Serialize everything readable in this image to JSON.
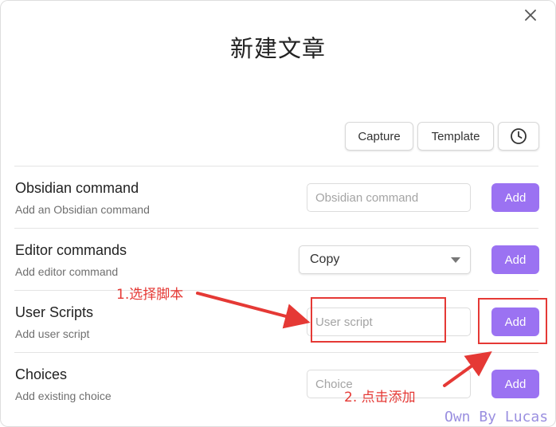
{
  "modal": {
    "title": "新建文章",
    "close_icon": "close-icon"
  },
  "toolbar": {
    "capture_label": "Capture",
    "template_label": "Template",
    "history_icon": "clock-icon"
  },
  "rows": {
    "obsidian_command": {
      "title": "Obsidian command",
      "description": "Add an Obsidian command",
      "placeholder": "Obsidian command",
      "add_label": "Add"
    },
    "editor_commands": {
      "title": "Editor commands",
      "description": "Add editor command",
      "selected": "Copy",
      "add_label": "Add"
    },
    "user_scripts": {
      "title": "User Scripts",
      "description": "Add user script",
      "placeholder": "User script",
      "add_label": "Add"
    },
    "choices": {
      "title": "Choices",
      "description": "Add existing choice",
      "placeholder": "Choice",
      "add_label": "Add"
    }
  },
  "annotations": {
    "step1": "1.选择脚本",
    "step2": "2. 点击添加",
    "color": "#e53935"
  },
  "watermark": "Own By Lucas",
  "colors": {
    "accent": "#9b72f2",
    "annotation": "#e53935"
  }
}
